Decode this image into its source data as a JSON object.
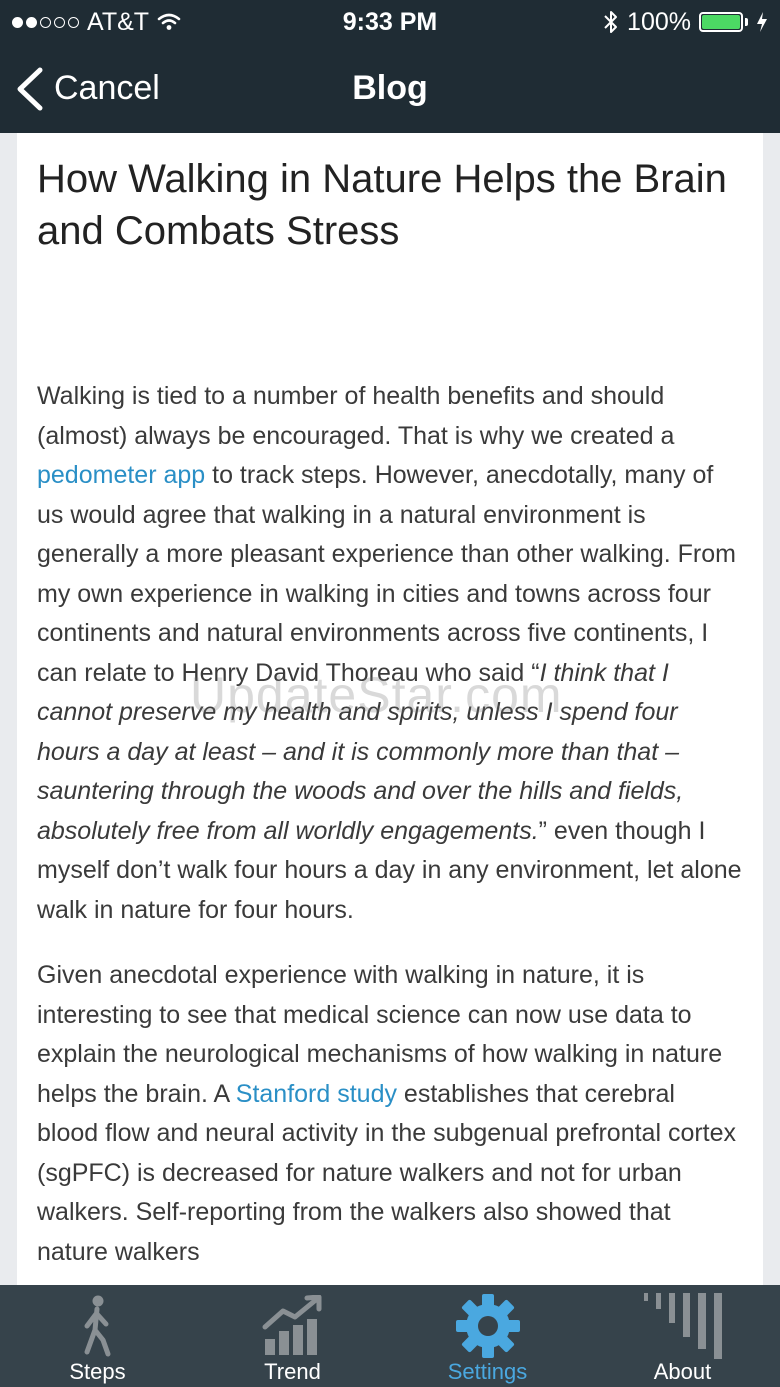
{
  "status_bar": {
    "carrier": "AT&T",
    "time": "9:33 PM",
    "battery": "100%"
  },
  "nav": {
    "back_label": "Cancel",
    "title": "Blog"
  },
  "article": {
    "title": "How Walking in Nature Helps the Brain and Combats Stress",
    "p1_a": "Walking is tied to a number of  health benefits and should (almost) always be encouraged. That is why we created a ",
    "p1_link": "pedometer app",
    "p1_b": " to track steps. However, anecdotally, many of us would agree that walking in a natural environment is generally a more pleasant experience than other walking. From my own experience in walking in cities and towns across four continents and natural environments across five continents, I can relate to Henry David Thoreau who said “",
    "p1_quote": "I think that I cannot preserve my health and spirits, unless I spend four hours a day at least – and it is commonly more than that – sauntering through the woods and over the hills and fields,  absolutely free from all worldly engagements.",
    "p1_c": "” even though I myself don’t walk four hours a day in any environment, let alone walk in nature for four hours.",
    "p2_a": "Given anecdotal experience with walking in nature, it is interesting to see that medical science can now use data to explain the neurological mechanisms of how walking in nature helps the brain. A ",
    "p2_link": "Stanford study",
    "p2_b": " establishes that cerebral blood flow and neural activity in the subgenual prefrontal cortex (sgPFC) is decreased for nature walkers and not for urban walkers. Self-reporting from the walkers also showed that nature walkers"
  },
  "watermark": "UpdateStar.com",
  "tabs": [
    {
      "label": "Steps",
      "icon": "walker-icon"
    },
    {
      "label": "Trend",
      "icon": "trend-chart-icon"
    },
    {
      "label": "Settings",
      "icon": "gear-icon"
    },
    {
      "label": "About",
      "icon": "bars-icon"
    }
  ],
  "colors": {
    "bar": "#1f2c34",
    "tab_bar": "#36434b",
    "link": "#2a8fc6",
    "active_tab": "#4aa8e0"
  }
}
